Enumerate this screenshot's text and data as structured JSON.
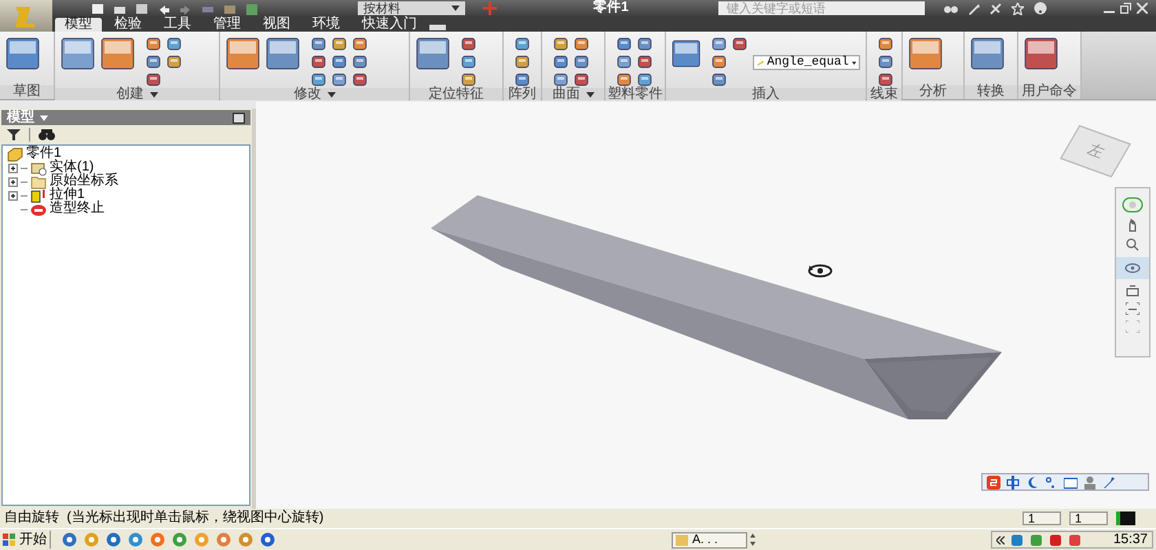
{
  "app": {
    "title": "零件1",
    "material": "按材料",
    "search_placeholder": "键入关键字或短语"
  },
  "tabs": [
    {
      "label": "模型",
      "selected": true
    },
    {
      "label": "检验",
      "selected": false
    },
    {
      "label": "工具",
      "selected": false
    },
    {
      "label": "管理",
      "selected": false
    },
    {
      "label": "视图",
      "selected": false
    },
    {
      "label": "环境",
      "selected": false
    },
    {
      "label": "快速入门",
      "selected": false
    }
  ],
  "ribbon_groups": [
    {
      "label": "草图",
      "has_menu": false
    },
    {
      "label": "创建",
      "has_menu": true
    },
    {
      "label": "修改",
      "has_menu": true
    },
    {
      "label": "定位特征",
      "has_menu": false
    },
    {
      "label": "阵列",
      "has_menu": false
    },
    {
      "label": "曲面",
      "has_menu": true
    },
    {
      "label": "塑料零件",
      "has_menu": false
    },
    {
      "label": "插入",
      "has_menu": false,
      "combo": "Angle_equal"
    },
    {
      "label": "线束",
      "has_menu": false
    },
    {
      "label": "分析",
      "has_menu": false
    },
    {
      "label": "转换",
      "has_menu": false
    },
    {
      "label": "用户命令",
      "has_menu": false
    }
  ],
  "browser": {
    "title": "模型",
    "tree": [
      {
        "label": "零件1",
        "kind": "part",
        "expandable": false,
        "children": [
          {
            "label": "实体(1)",
            "kind": "solid",
            "expandable": true
          },
          {
            "label": "原始坐标系",
            "kind": "folder",
            "expandable": true
          },
          {
            "label": "拉伸1",
            "kind": "extrude",
            "expandable": true
          },
          {
            "label": "造型终止",
            "kind": "end",
            "expandable": false
          }
        ]
      }
    ]
  },
  "view_cube": {
    "face": "左"
  },
  "status_bar": {
    "message": "自由旋转  (当光标出现时单击鼠标，绕视图中心旋转)",
    "fields": [
      "1",
      "1"
    ]
  },
  "taskbar": {
    "start": "开始",
    "task": "A. . .",
    "clock": "15:37"
  }
}
